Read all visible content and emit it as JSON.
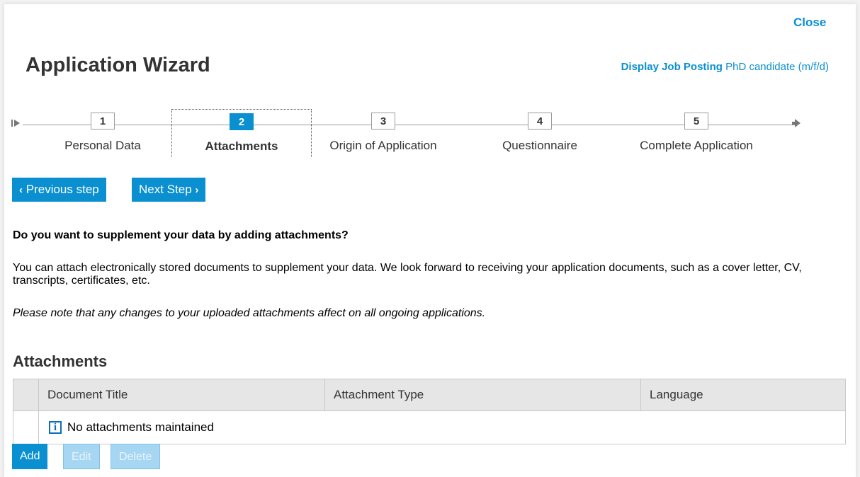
{
  "header": {
    "close_label": "Close",
    "title": "Application Wizard",
    "job_posting_link": "Display Job Posting",
    "job_title": "PhD candidate (m/f/d)"
  },
  "roadmap": {
    "start_icon": "roadmap-start-icon",
    "end_icon": "roadmap-end-icon",
    "active_step": 2,
    "steps": [
      {
        "number": "1",
        "label": "Personal Data"
      },
      {
        "number": "2",
        "label": "Attachments"
      },
      {
        "number": "3",
        "label": "Origin of Application"
      },
      {
        "number": "4",
        "label": "Questionnaire"
      },
      {
        "number": "5",
        "label": "Complete Application"
      }
    ]
  },
  "nav": {
    "previous_label": "Previous step",
    "next_label": "Next Step"
  },
  "content": {
    "question": "Do you want to supplement your data by adding attachments?",
    "paragraph": "You can attach electronically stored documents to supplement your data. We look forward to receiving your application documents, such as a cover letter, CV, transcripts, certificates, etc.",
    "note": "Please note that any changes to your uploaded attachments affect on all ongoing applications."
  },
  "attachments": {
    "section_title": "Attachments",
    "columns": [
      "Document Title",
      "Attachment Type",
      "Language"
    ],
    "empty_message": "No attachments maintained",
    "buttons": {
      "add": "Add",
      "edit": "Edit",
      "delete": "Delete"
    }
  },
  "colors": {
    "accent": "#0a8fd1",
    "disabled_button": "#a6d6f2",
    "table_header": "#e6e6e6"
  }
}
